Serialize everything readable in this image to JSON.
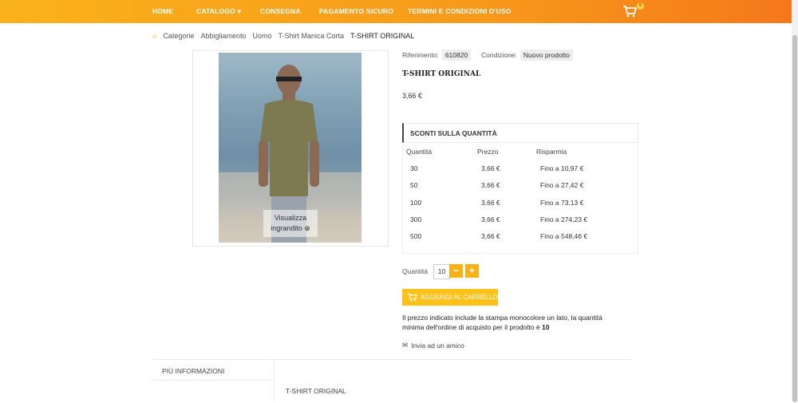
{
  "nav": {
    "items": [
      "HOME",
      "CATALOGO ▾",
      "CONSEGNA",
      "PAGAMENTO SICURO",
      "TERMINI E CONDIZIONI D'USO"
    ],
    "cart_count": "0"
  },
  "breadcrumb": [
    "Categorie",
    "Abbigliamento",
    "Uomo",
    "T-Shirt Manica Corta",
    "T-SHIRT ORIGINAL"
  ],
  "image": {
    "zoom_label_1": "Visualizza",
    "zoom_label_2": "ingrandito"
  },
  "product": {
    "ref_label": "Riferimento:",
    "ref_value": "610820",
    "cond_label": "Condizione:",
    "cond_value": "Nuovo prodotto",
    "title": "T-SHIRT ORIGINAL",
    "price": "3,66 €"
  },
  "discounts": {
    "header": "SCONTI SULLA QUANTITÀ",
    "columns": [
      "Quantità",
      "Prezzo",
      "Risparmia"
    ],
    "rows": [
      [
        "30",
        "3,66 €",
        "Fino a 10,97 €"
      ],
      [
        "50",
        "3,66 €",
        "Fino a 27,42 €"
      ],
      [
        "100",
        "3,66 €",
        "Fino a 73,13 €"
      ],
      [
        "300",
        "3,66 €",
        "Fino a 274,23 €"
      ],
      [
        "500",
        "3,66 €",
        "Fino a 548,46 €"
      ]
    ]
  },
  "quantity": {
    "label": "Quantità",
    "value": "10",
    "minus": "−",
    "plus": "+"
  },
  "add_to_cart": "AGGIUNGI AL CARRELLO",
  "note_line1": "Il prezzo indicato include la stampa monocolore un lato, la quantità",
  "note_line2_prefix": "minima dell'ordine di acquisto per il prodotto è ",
  "note_min": "10",
  "send_friend": "Invia ad un amico",
  "tabs": {
    "more_info": "PIÙ INFORMAZIONI",
    "content_title": "T-SHIRT ORIGINAL"
  },
  "colors": {
    "accent": "#f7a01a",
    "button": "#ffc21a"
  }
}
